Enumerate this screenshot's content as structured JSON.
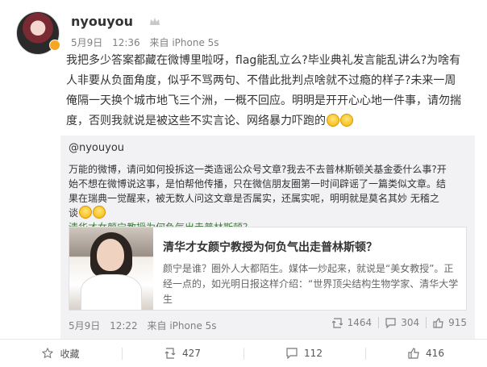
{
  "post": {
    "username": "nyouyou",
    "date": "5月9日",
    "time": "12:36",
    "source": "来自 iPhone 5s",
    "text": "我把多少答案都藏在微博里啦呀，flag能乱立么?毕业典礼发言能乱讲么?为啥有人非要从负面角度，似乎不骂两句、不借此批判点啥就不过瘾的样子?未来一周俺隔一天换个城市地飞三个洲，一概不回应。明明是开开心心地一件事，请勿揣度，否则我就说是被这些不实言论、网络暴力吓跑的"
  },
  "repost": {
    "username": "@nyouyou",
    "text": "万能的微博，请问如何投拆这一类造谣公众号文章?我去不去普林斯顿关基金委什么事?开始不想在微博说这事，是怕帮他传播，只在微信朋友圈第一时间辟谣了一篇类似文章。结果在瑞典一觉醒来，被无数人问这文章是否属实，还属实呢，明明就是莫名其妙 无稽之谈",
    "link_text": "清华才女颜宁教授为何负气出走普林斯顿？",
    "card": {
      "title": "清华才女颜宁教授为何负气出走普林斯顿？",
      "description": "颜宁是谁？圈外人大都陌生。媒体一炒起来，就说是“美女教授”。正经一点的，如光明日报这样介绍：“世界顶尖结构生物学家、清华大学生"
    },
    "date": "5月9日",
    "time": "12:22",
    "source": "来自 iPhone 5s",
    "stats": {
      "reposts": "1464",
      "comments": "304",
      "likes": "915"
    }
  },
  "footer": {
    "favorite_label": "收藏",
    "repost_count": "427",
    "comment_count": "112",
    "like_count": "416"
  },
  "icons": {
    "avatar": "user-avatar",
    "vip": "crown-icon",
    "repost": "repost-icon",
    "comment": "comment-icon",
    "like": "thumbs-up-icon",
    "favorite": "star-icon"
  },
  "colors": {
    "link_green": "#3d7a3a",
    "repost_bg": "#f2f2f5",
    "meta_gray": "#808080"
  }
}
